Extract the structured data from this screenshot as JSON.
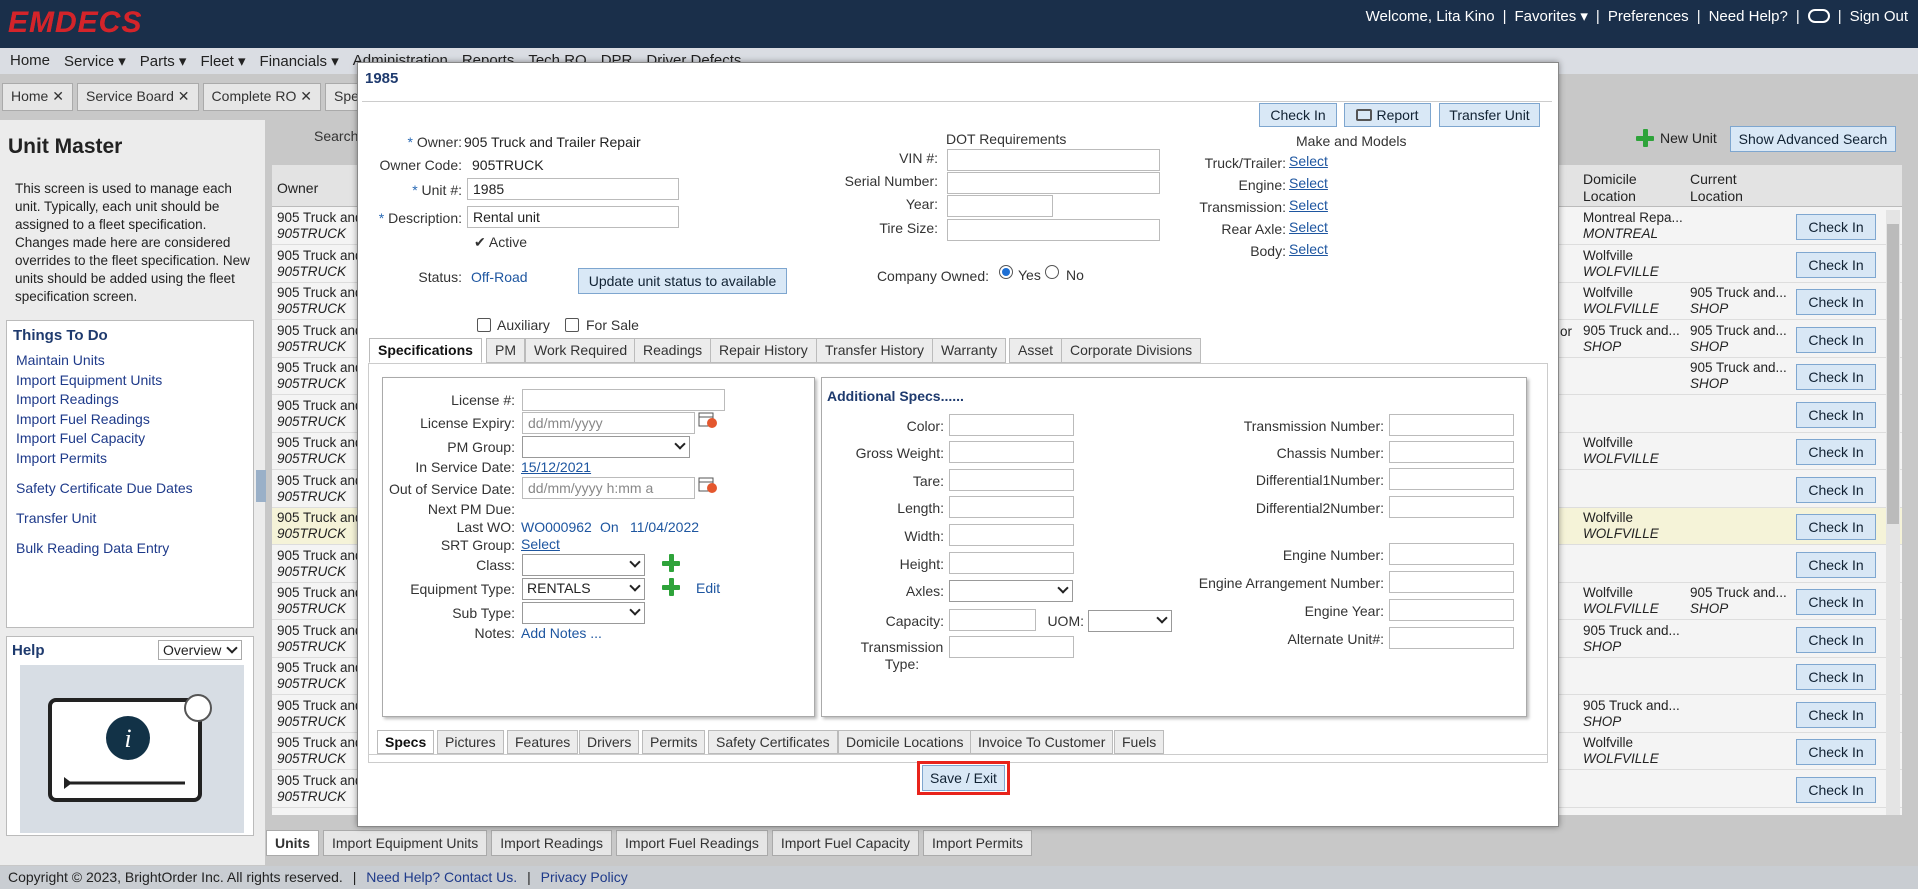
{
  "app": {
    "logo": "EMDECS",
    "welcome": "Welcome, Lita Kino",
    "favorites": "Favorites",
    "preferences": "Preferences",
    "need_help": "Need Help?",
    "signout": "Sign Out"
  },
  "menu": [
    "Home",
    "Service",
    "Parts",
    "Fleet",
    "Financials",
    "Administration",
    "Reports",
    "Tech RO",
    "DPR",
    "Driver Defects"
  ],
  "page_tabs": [
    "Home",
    "Service Board",
    "Complete RO",
    "Specifi"
  ],
  "left": {
    "title": "Unit Master",
    "description": "This screen is used to manage each unit. Typically, each unit should be assigned to a fleet specification. Changes made here are considered overrides to the fleet specification. New units should be added using the fleet specification screen.",
    "todo_title": "Things To Do",
    "todo": [
      "Maintain Units",
      "Import Equipment Units",
      "Import Readings",
      "Import Fuel Readings",
      "Import Fuel Capacity",
      "Import Permits",
      "Safety Certificate Due Dates",
      "Transfer Unit",
      "Bulk Reading Data Entry"
    ],
    "help_title": "Help",
    "help_select": "Overview"
  },
  "grid": {
    "search": "Search",
    "new_unit": "New Unit",
    "adv_search": "Show Advanced Search",
    "col_owner": "Owner",
    "col_domicile": "Domicile Location",
    "col_current": "Current Location",
    "check_in": "Check In",
    "owner_name": "905 Truck and",
    "owner_code": "905TRUCK",
    "domiciles": [
      [
        "Montreal Repa...",
        "MONTREAL"
      ],
      [
        "Wolfville",
        "WOLFVILLE"
      ],
      [
        "Wolfville",
        "WOLFVILLE"
      ],
      [
        "905 Truck and...",
        "SHOP"
      ],
      [
        "",
        ""
      ],
      [
        "",
        ""
      ],
      [
        "Wolfville",
        "WOLFVILLE"
      ],
      [
        "",
        ""
      ],
      [
        "Wolfville",
        "WOLFVILLE"
      ],
      [
        "",
        ""
      ],
      [
        "Wolfville",
        "WOLFVILLE"
      ],
      [
        "905 Truck and...",
        "SHOP"
      ],
      [
        "",
        ""
      ],
      [
        "905 Truck and...",
        "SHOP"
      ],
      [
        "Wolfville",
        "WOLFVILLE"
      ],
      [
        "",
        ""
      ]
    ],
    "currents": [
      [
        "",
        ""
      ],
      [
        "",
        ""
      ],
      [
        "905 Truck and...",
        "SHOP"
      ],
      [
        "905 Truck and...",
        "SHOP"
      ],
      [
        "905 Truck and...",
        "SHOP"
      ],
      [
        "",
        ""
      ],
      [
        "",
        ""
      ],
      [
        "",
        ""
      ],
      [
        "",
        ""
      ],
      [
        "",
        ""
      ],
      [
        "905 Truck and...",
        "SHOP"
      ],
      [
        "",
        ""
      ],
      [
        "",
        ""
      ],
      [
        "",
        ""
      ],
      [
        "",
        ""
      ],
      [
        "",
        ""
      ]
    ],
    "row_suffix": "or"
  },
  "bottom_tabs": [
    "Units",
    "Import Equipment Units",
    "Import Readings",
    "Import Fuel Readings",
    "Import Fuel Capacity",
    "Import Permits"
  ],
  "footer": {
    "copyright": "Copyright © 2023, BrightOrder Inc. All rights reserved.",
    "help": "Need Help? Contact Us.",
    "privacy": "Privacy Policy"
  },
  "modal": {
    "title": "1985",
    "buttons": {
      "check_in": "Check In",
      "report": "Report",
      "transfer": "Transfer Unit",
      "update_status": "Update unit status to available",
      "save_exit": "Save / Exit"
    },
    "owner_label": "Owner:",
    "owner_value": "905 Truck and Trailer Repair",
    "owner_code_label": "Owner Code:",
    "owner_code_value": "905TRUCK",
    "unit_label": "Unit #:",
    "unit_value": "1985",
    "desc_label": "Description:",
    "desc_value": "Rental unit",
    "active_label": "Active",
    "status_label": "Status:",
    "status_value": "Off-Road",
    "aux_label": "Auxiliary",
    "forsale_label": "For Sale",
    "dot_title": "DOT Requirements",
    "vin_label": "VIN #:",
    "serial_label": "Serial Number:",
    "year_label": "Year:",
    "tire_label": "Tire Size:",
    "company_owned_label": "Company Owned:",
    "yes": "Yes",
    "no": "No",
    "make_title": "Make and Models",
    "truck_label": "Truck/Trailer:",
    "engine_label": "Engine:",
    "trans_label": "Transmission:",
    "rear_label": "Rear Axle:",
    "body_label": "Body:",
    "select": "Select",
    "tabs": [
      "Specifications",
      "PM",
      "Work Required",
      "Readings",
      "Repair History",
      "Transfer History",
      "Warranty",
      "Asset",
      "Corporate Divisions"
    ],
    "spec": {
      "license_label": "License #:",
      "expiry_label": "License Expiry:",
      "expiry_ph": "dd/mm/yyyy",
      "pmgroup_label": "PM Group:",
      "inservice_label": "In Service Date:",
      "inservice_value": "15/12/2021",
      "outservice_label": "Out of Service Date:",
      "outservice_ph": "dd/mm/yyyy h:mm a",
      "nextpm_label": "Next PM Due:",
      "lastwo_label": "Last WO:",
      "lastwo_value": "WO000962",
      "on": "On",
      "lastwo_date": "11/04/2022",
      "srt_label": "SRT Group:",
      "class_label": "Class:",
      "eqtype_label": "Equipment Type:",
      "eqtype_value": "RENTALS",
      "edit": "Edit",
      "subtype_label": "Sub Type:",
      "notes_label": "Notes:",
      "notes_link": "Add Notes ..."
    },
    "add": {
      "title": "Additional Specs......",
      "color": "Color:",
      "gross": "Gross Weight:",
      "tare": "Tare:",
      "length": "Length:",
      "width": "Width:",
      "height": "Height:",
      "axles": "Axles:",
      "capacity": "Capacity:",
      "uom": "UOM:",
      "trans_type": "Transmission Type:",
      "trans_num": "Transmission Number:",
      "chassis": "Chassis Number:",
      "diff1": "Differential1Number:",
      "diff2": "Differential2Number:",
      "engine_num": "Engine Number:",
      "engine_arr": "Engine Arrangement Number:",
      "engine_year": "Engine Year:",
      "alt_unit": "Alternate Unit#:"
    },
    "bottom_tabs": [
      "Specs",
      "Pictures",
      "Features",
      "Drivers",
      "Permits",
      "Safety Certificates",
      "Domicile Locations",
      "Invoice To Customer",
      "Fuels"
    ]
  },
  "colors": {
    "brand_red": "#d4242a",
    "navy": "#1a2f4a",
    "link": "#1e56a0",
    "highlight": "#e8231b"
  }
}
